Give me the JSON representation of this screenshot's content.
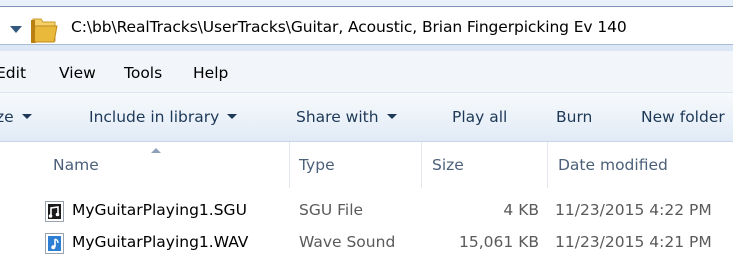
{
  "address_bar": {
    "path": "C:\\bb\\RealTracks\\UserTracks\\Guitar, Acoustic, Brian Fingerpicking Ev 140",
    "back_icon": "dropdown-arrow-icon",
    "folder_icon": "folder-icon"
  },
  "menu": {
    "items": [
      "Edit",
      "View",
      "Tools",
      "Help"
    ]
  },
  "commands": {
    "organize": "ze",
    "include_in_library": "Include in library",
    "share_with": "Share with",
    "play_all": "Play all",
    "burn": "Burn",
    "new_folder": "New folder"
  },
  "columns": {
    "name": "Name",
    "type": "Type",
    "size": "Size",
    "date_modified": "Date modified"
  },
  "files": [
    {
      "name": "MyGuitarPlaying1.SGU",
      "type": "SGU File",
      "size": "4 KB",
      "date": "11/23/2015 4:22 PM",
      "icon": "sgu-file-icon"
    },
    {
      "name": "MyGuitarPlaying1.WAV",
      "type": "Wave Sound",
      "size": "15,061 KB",
      "date": "11/23/2015 4:21 PM",
      "icon": "wave-sound-icon"
    }
  ],
  "colors": {
    "command_text": "#1e3957",
    "header_text": "#4c607a",
    "folder_yellow": "#e8b93a",
    "wav_icon_blue": "#2d7fd3"
  }
}
